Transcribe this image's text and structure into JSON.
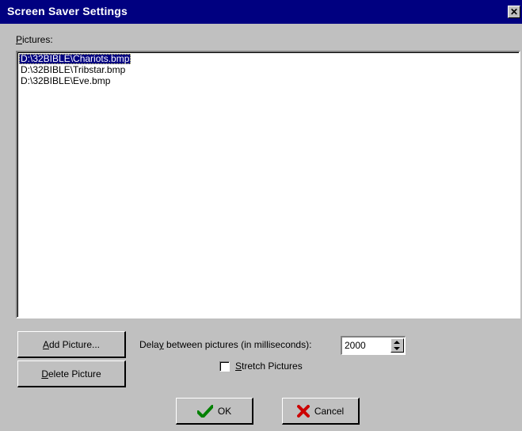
{
  "window": {
    "title": "Screen Saver Settings",
    "close_label": "✕",
    "titlebar_color": "#000080",
    "face_color": "#c0c0c0"
  },
  "pictures": {
    "label_mnemonic": "P",
    "label_rest": "ictures:",
    "items": [
      {
        "text": "D:\\32BIBLE\\Chariots.bmp",
        "selected": true
      },
      {
        "text": "D:\\32BIBLE\\Tribstar.bmp",
        "selected": false
      },
      {
        "text": "D:\\32BIBLE\\Eve.bmp",
        "selected": false
      }
    ]
  },
  "buttons": {
    "add_picture": {
      "mnemonic": "A",
      "rest": "dd Picture..."
    },
    "delete_picture": {
      "mnemonic": "D",
      "rest": "elete Picture"
    },
    "ok": {
      "label": "OK",
      "icon": "checkmark-icon",
      "icon_color": "#008000"
    },
    "cancel": {
      "label": "Cancel",
      "icon": "x-icon",
      "icon_color": "#cc0000"
    }
  },
  "delay": {
    "label_pre": "Dela",
    "label_mnemonic": "y",
    "label_post": " between pictures (in milliseconds):",
    "value": "2000"
  },
  "stretch": {
    "mnemonic": "S",
    "rest": "tretch Pictures",
    "checked": false
  }
}
